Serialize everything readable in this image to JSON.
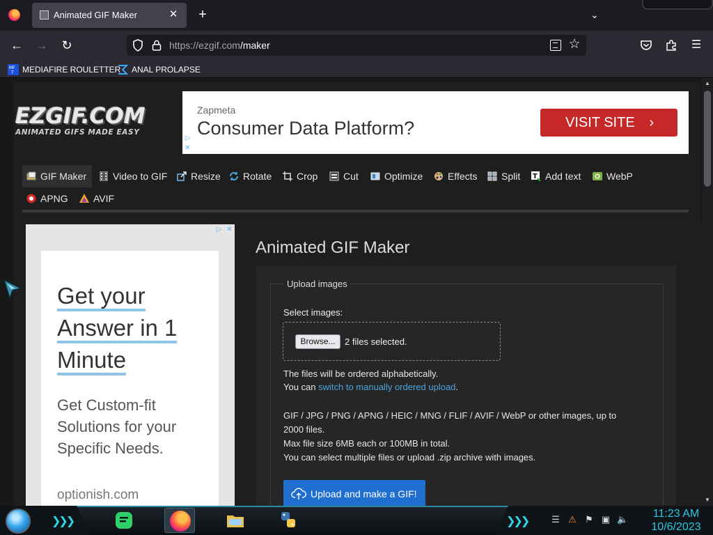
{
  "browser": {
    "tab_title": "Animated GIF Maker",
    "url_host": "https://ezgif.com",
    "url_path": "/maker",
    "bookmarks": [
      {
        "label": "MEDIAFIRE ROULETTER"
      },
      {
        "label": "ANAL PROLAPSE"
      }
    ]
  },
  "site": {
    "logo_main": "EZGIF.COM",
    "logo_sub": "ANIMATED GIFS MADE EASY",
    "menu": [
      {
        "label": "GIF Maker",
        "icon": "gif-maker-icon"
      },
      {
        "label": "Video to GIF",
        "icon": "film-icon"
      },
      {
        "label": "Resize",
        "icon": "resize-icon"
      },
      {
        "label": "Rotate",
        "icon": "rotate-icon"
      },
      {
        "label": "Crop",
        "icon": "crop-icon"
      },
      {
        "label": "Cut",
        "icon": "cut-icon"
      },
      {
        "label": "Optimize",
        "icon": "optimize-icon"
      },
      {
        "label": "Effects",
        "icon": "palette-icon"
      },
      {
        "label": "Split",
        "icon": "split-icon"
      },
      {
        "label": "Add text",
        "icon": "text-icon"
      },
      {
        "label": "WebP",
        "icon": "webp-icon"
      },
      {
        "label": "APNG",
        "icon": "apng-icon"
      },
      {
        "label": "AVIF",
        "icon": "avif-icon"
      }
    ]
  },
  "top_ad": {
    "brand": "Zapmeta",
    "title": "Consumer Data Platform?",
    "button": "VISIT SITE"
  },
  "side_ad": {
    "headline_lines": [
      "Get your",
      "Answer in 1",
      "Minute"
    ],
    "body": "Get Custom-fit Solutions for your Specific Needs.",
    "url": "optionish.com"
  },
  "main": {
    "title": "Animated GIF Maker",
    "legend": "Upload images",
    "select_label": "Select images:",
    "browse_button": "Browse...",
    "files_selected": "2 files selected.",
    "ordered_note": "The files will be ordered alphabetically.",
    "switch_prefix": "You can ",
    "switch_link": "switch to manually ordered upload",
    "switch_suffix": ".",
    "formats_line1": "GIF / JPG / PNG / APNG / HEIC / MNG / FLIF / AVIF / WebP or other images, up to",
    "formats_line2": "2000 files.",
    "max_size": "Max file size 6MB each or 100MB in total.",
    "multi_note": "You can select multiple files or upload .zip archive with images.",
    "upload_button": "Upload and make a GIF!"
  },
  "taskbar": {
    "time": "11:23 AM",
    "date": "10/6/2023"
  },
  "colors": {
    "accent_link": "#4aa3df",
    "upload_button": "#1f6fd1",
    "ad_button": "#c62828",
    "clock": "#29c7e0"
  }
}
